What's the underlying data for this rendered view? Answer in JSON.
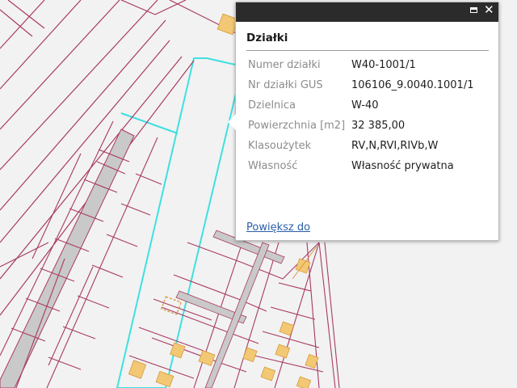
{
  "colors": {
    "parcel_boundary": "#a83a63",
    "district_boundary": "#3fe0e0",
    "building_fill": "#f3c875",
    "building_outline": "#d49a38",
    "road_fill": "#c9c9c9",
    "popup_titlebar": "#2b2b2b",
    "link": "#2a5fa8"
  },
  "popup": {
    "title": "Działki",
    "controls": {
      "maximize_icon": "maximize-icon",
      "close_icon": "close-icon",
      "close_glyph": "✕"
    },
    "attributes": [
      {
        "label": "Numer działki",
        "value": "W40-1001/1"
      },
      {
        "label": "Nr działki GUS",
        "value": "106106_9.0040.1001/1"
      },
      {
        "label": "Dzielnica",
        "value": "W-40"
      },
      {
        "label": "Powierzchnia [m2]",
        "value": "32 385,00"
      },
      {
        "label": "Klasoużytek",
        "value": "RV,N,RVI,RIVb,W"
      },
      {
        "label": "Własność",
        "value": "Własność prywatna"
      }
    ],
    "zoom_link": "Powiększ do"
  }
}
